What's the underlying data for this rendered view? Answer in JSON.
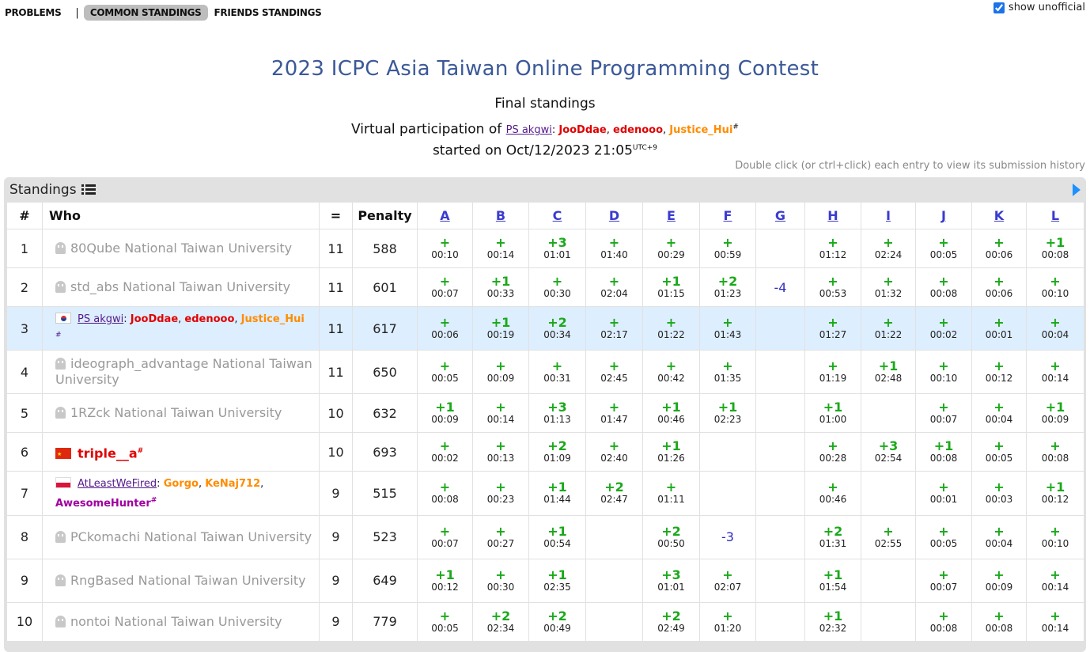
{
  "nav": {
    "problems": "PROBLEMS",
    "separator": "|",
    "common": "COMMON STANDINGS",
    "friends": "FRIENDS STANDINGS"
  },
  "show_unofficial": {
    "label": "show unofficial",
    "checked": true
  },
  "contest_title": "2023 ICPC Asia Taiwan Online Programming Contest",
  "subtitle": "Final standings",
  "virtual": {
    "prefix": "Virtual participation of",
    "team": "PS akgwi",
    "colon": ":",
    "members": [
      "JooDdae",
      "edenooo",
      "Justice_Hui"
    ],
    "hash": "#",
    "started": "started on Oct/12/2023 21:05",
    "tz": "UTC+9"
  },
  "hint": "Double click (or ctrl+click) each entry to view its submission history",
  "standings_label": "Standings",
  "headers": {
    "rank": "#",
    "who": "Who",
    "solved": "=",
    "penalty": "Penalty"
  },
  "problems": [
    "A",
    "B",
    "C",
    "D",
    "E",
    "F",
    "G",
    "H",
    "I",
    "J",
    "K",
    "L"
  ],
  "rows": [
    {
      "rank": "1",
      "team": "80Qube",
      "uni": "National Taiwan University",
      "solved": "11",
      "penalty": "588",
      "cells": [
        [
          "+",
          "00:10"
        ],
        [
          "+",
          "00:14"
        ],
        [
          "+3",
          "01:01"
        ],
        [
          "+",
          "01:40"
        ],
        [
          "+",
          "00:29"
        ],
        [
          "+",
          "00:59"
        ],
        [
          "",
          ""
        ],
        [
          "+",
          "01:12"
        ],
        [
          "+",
          "02:24"
        ],
        [
          "+",
          "00:05"
        ],
        [
          "+",
          "00:06"
        ],
        [
          "+1",
          "00:08"
        ]
      ]
    },
    {
      "rank": "2",
      "team": "std_abs",
      "uni": "National Taiwan University",
      "solved": "11",
      "penalty": "601",
      "cells": [
        [
          "+",
          "00:07"
        ],
        [
          "+1",
          "00:33"
        ],
        [
          "+",
          "00:30"
        ],
        [
          "+",
          "02:04"
        ],
        [
          "+1",
          "01:15"
        ],
        [
          "+2",
          "01:23"
        ],
        [
          "-4",
          ""
        ],
        [
          "+",
          "00:53"
        ],
        [
          "+",
          "01:32"
        ],
        [
          "+",
          "00:08"
        ],
        [
          "+",
          "00:06"
        ],
        [
          "+",
          "00:10"
        ]
      ]
    },
    {
      "rank": "3",
      "team": "PS akgwi",
      "solved": "11",
      "penalty": "617",
      "cells": [
        [
          "+",
          "00:06"
        ],
        [
          "+1",
          "00:19"
        ],
        [
          "+2",
          "00:34"
        ],
        [
          "+",
          "02:17"
        ],
        [
          "+",
          "01:22"
        ],
        [
          "+",
          "01:43"
        ],
        [
          "",
          ""
        ],
        [
          "+",
          "01:27"
        ],
        [
          "+",
          "01:22"
        ],
        [
          "+",
          "00:02"
        ],
        [
          "+",
          "00:01"
        ],
        [
          "+",
          "00:04"
        ]
      ]
    },
    {
      "rank": "4",
      "team": "ideograph_advantage",
      "uni": "National Taiwan University",
      "solved": "11",
      "penalty": "650",
      "cells": [
        [
          "+",
          "00:05"
        ],
        [
          "+",
          "00:09"
        ],
        [
          "+",
          "00:31"
        ],
        [
          "+",
          "02:45"
        ],
        [
          "+",
          "00:42"
        ],
        [
          "+",
          "01:35"
        ],
        [
          "",
          ""
        ],
        [
          "+",
          "01:19"
        ],
        [
          "+1",
          "02:48"
        ],
        [
          "+",
          "00:10"
        ],
        [
          "+",
          "00:12"
        ],
        [
          "+",
          "00:14"
        ]
      ]
    },
    {
      "rank": "5",
      "team": "1RZck",
      "uni": "National Taiwan University",
      "solved": "10",
      "penalty": "632",
      "cells": [
        [
          "+1",
          "00:09"
        ],
        [
          "+",
          "00:14"
        ],
        [
          "+3",
          "01:13"
        ],
        [
          "+",
          "01:47"
        ],
        [
          "+1",
          "00:46"
        ],
        [
          "+1",
          "02:23"
        ],
        [
          "",
          ""
        ],
        [
          "+1",
          "01:00"
        ],
        [
          "",
          ""
        ],
        [
          "+",
          "00:07"
        ],
        [
          "+",
          "00:04"
        ],
        [
          "+1",
          "00:09"
        ]
      ]
    },
    {
      "rank": "6",
      "team": "triple__a",
      "solved": "10",
      "penalty": "693",
      "cells": [
        [
          "+",
          "00:02"
        ],
        [
          "+",
          "00:13"
        ],
        [
          "+2",
          "01:09"
        ],
        [
          "+",
          "02:40"
        ],
        [
          "+1",
          "01:26"
        ],
        [
          "",
          ""
        ],
        [
          "",
          ""
        ],
        [
          "+",
          "00:28"
        ],
        [
          "+3",
          "02:54"
        ],
        [
          "+1",
          "00:08"
        ],
        [
          "+",
          "00:05"
        ],
        [
          "+",
          "00:08"
        ]
      ]
    },
    {
      "rank": "7",
      "team": "AtLeastWeFired",
      "members": [
        "Gorgo",
        "KeNaj712",
        "AwesomeHunter"
      ],
      "solved": "9",
      "penalty": "515",
      "cells": [
        [
          "+",
          "00:08"
        ],
        [
          "+",
          "00:23"
        ],
        [
          "+1",
          "01:44"
        ],
        [
          "+2",
          "02:47"
        ],
        [
          "+",
          "01:11"
        ],
        [
          "",
          ""
        ],
        [
          "",
          ""
        ],
        [
          "+",
          "00:46"
        ],
        [
          "",
          ""
        ],
        [
          "+",
          "00:01"
        ],
        [
          "+",
          "00:03"
        ],
        [
          "+1",
          "00:12"
        ]
      ]
    },
    {
      "rank": "8",
      "team": "PCkomachi",
      "uni": "National Taiwan University",
      "solved": "9",
      "penalty": "523",
      "cells": [
        [
          "+",
          "00:07"
        ],
        [
          "+",
          "00:27"
        ],
        [
          "+1",
          "00:54"
        ],
        [
          "",
          ""
        ],
        [
          "+2",
          "00:50"
        ],
        [
          "-3",
          ""
        ],
        [
          "",
          ""
        ],
        [
          "+2",
          "01:31"
        ],
        [
          "+",
          "02:55"
        ],
        [
          "+",
          "00:05"
        ],
        [
          "+",
          "00:04"
        ],
        [
          "+",
          "00:10"
        ]
      ]
    },
    {
      "rank": "9",
      "team": "RngBased",
      "uni": "National Taiwan University",
      "solved": "9",
      "penalty": "649",
      "cells": [
        [
          "+1",
          "00:12"
        ],
        [
          "+",
          "00:30"
        ],
        [
          "+1",
          "02:35"
        ],
        [
          "",
          ""
        ],
        [
          "+3",
          "01:01"
        ],
        [
          "+",
          "02:07"
        ],
        [
          "",
          ""
        ],
        [
          "+1",
          "01:54"
        ],
        [
          "",
          ""
        ],
        [
          "+",
          "00:07"
        ],
        [
          "+",
          "00:09"
        ],
        [
          "+",
          "00:14"
        ]
      ]
    },
    {
      "rank": "10",
      "team": "nontoi",
      "uni": "National Taiwan University",
      "solved": "9",
      "penalty": "779",
      "cells": [
        [
          "+",
          "00:05"
        ],
        [
          "+2",
          "02:34"
        ],
        [
          "+2",
          "00:49"
        ],
        [
          "",
          ""
        ],
        [
          "+2",
          "02:49"
        ],
        [
          "+",
          "01:20"
        ],
        [
          "",
          ""
        ],
        [
          "+1",
          "02:32"
        ],
        [
          "",
          ""
        ],
        [
          "+",
          "00:08"
        ],
        [
          "+",
          "00:08"
        ],
        [
          "+",
          "00:14"
        ]
      ]
    }
  ],
  "colors": {
    "title": "#3b5998",
    "accepted": "#1aa91a",
    "rejected": "#2d2dbf",
    "highlight": "#ddeeff"
  }
}
